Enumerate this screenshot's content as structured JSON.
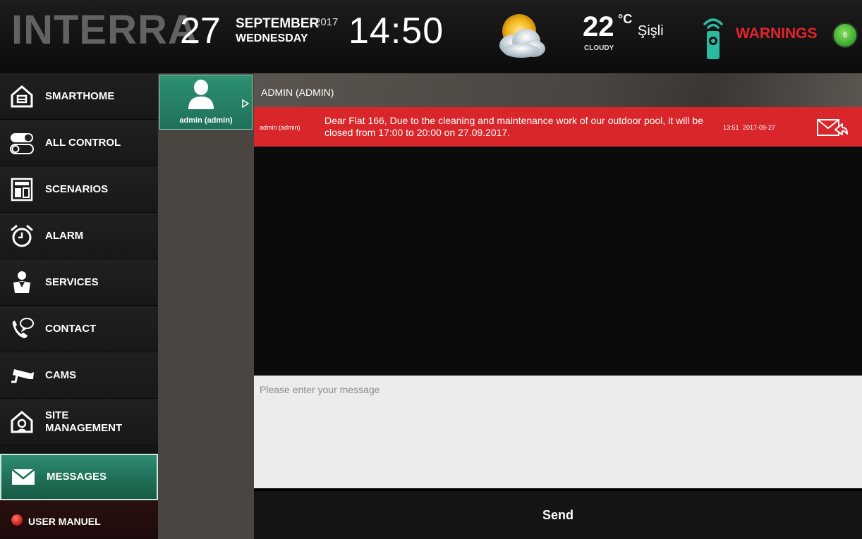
{
  "header": {
    "logo": "INTERRA",
    "day": "27",
    "month": "SEPTEMBER",
    "year": "2017",
    "weekday": "WEDNESDAY",
    "time": "14:50",
    "temperature": "22",
    "degree_unit": "°C",
    "city": "Şişli",
    "condition": "CLOUDY",
    "warnings_label": "WARNINGS",
    "warnings_count": "0"
  },
  "sidebar": {
    "items": [
      {
        "label": "SMARTHOME",
        "icon": "house-icon"
      },
      {
        "label": "ALL CONTROL",
        "icon": "toggle-icon"
      },
      {
        "label": "SCENARIOS",
        "icon": "scenario-panel-icon"
      },
      {
        "label": "ALARM",
        "icon": "alarm-clock-icon"
      },
      {
        "label": "SERVICES",
        "icon": "service-person-icon"
      },
      {
        "label": "CONTACT",
        "icon": "phone-bubble-icon"
      },
      {
        "label": "CAMS",
        "icon": "camera-icon"
      },
      {
        "label": "SITE",
        "label2": "MANAGEMENT",
        "icon": "site-house-icon"
      },
      {
        "label": "MESSAGES",
        "icon": "envelope-icon"
      }
    ],
    "manual_label": "USER MANUEL"
  },
  "contacts": [
    {
      "name": "admin (admin)"
    }
  ],
  "chat": {
    "title": "ADMIN (ADMIN)",
    "messages": [
      {
        "sender": "admin (admin)",
        "text": "Dear Flat 166, Due to the cleaning and maintenance work of our outdoor pool, it will be closed from 17:00 to 20:00 on 27.09.2017.",
        "time": "13:51",
        "date": "2017-09-27"
      }
    ],
    "input_placeholder": "Please enter your message",
    "send_label": "Send"
  },
  "colors": {
    "accent_green": "#1f7058",
    "message_red": "#d8262a",
    "warning_red": "#e8232b",
    "badge_green": "#35a82a"
  }
}
